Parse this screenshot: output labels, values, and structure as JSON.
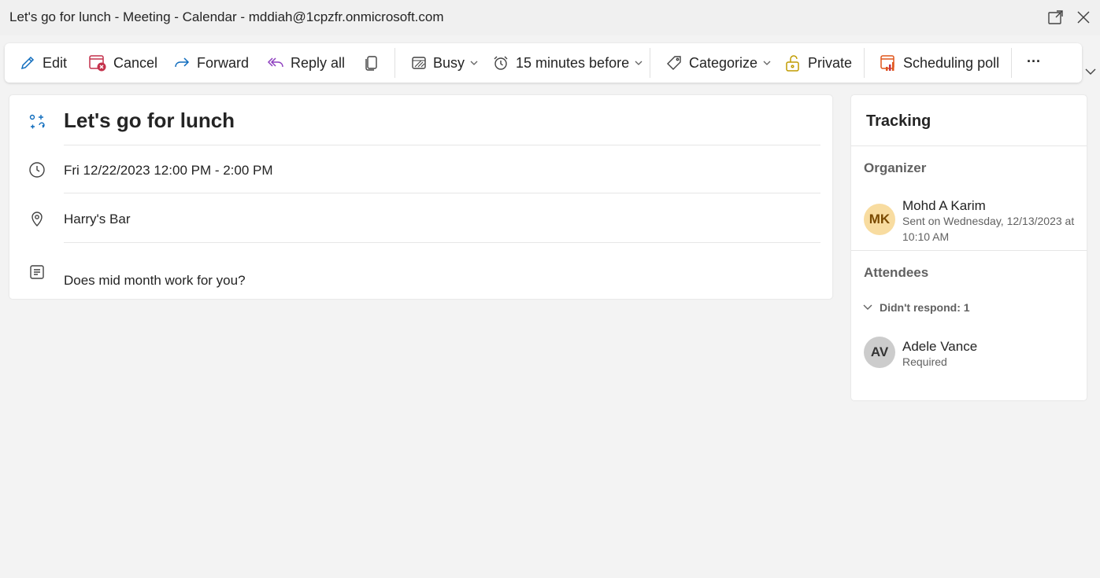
{
  "window": {
    "title": "Let's go for lunch - Meeting - Calendar - mddiah@1cpzfr.onmicrosoft.com"
  },
  "toolbar": {
    "edit": "Edit",
    "cancel": "Cancel",
    "forward": "Forward",
    "reply_all": "Reply all",
    "busy": "Busy",
    "reminder": "15 minutes before",
    "categorize": "Categorize",
    "private": "Private",
    "scheduling_poll": "Scheduling poll",
    "more": "···"
  },
  "meeting": {
    "title": "Let's go for lunch",
    "datetime": "Fri 12/22/2023 12:00 PM - 2:00 PM",
    "location": "Harry's Bar",
    "body": "Does mid month work for you?"
  },
  "tracking": {
    "header": "Tracking",
    "organizer_label": "Organizer",
    "organizer": {
      "initials": "MK",
      "name": "Mohd A Karim",
      "sent": "Sent on Wednesday, 12/13/2023 at 10:10 AM"
    },
    "attendees_label": "Attendees",
    "group_label": "Didn't respond: 1",
    "attendee": {
      "initials": "AV",
      "name": "Adele Vance",
      "role": "Required"
    }
  },
  "colors": {
    "accent": "#0f6cbd",
    "cancel_red": "#c4314b",
    "reply_purple": "#8e3fbf",
    "private_gold": "#c19c00",
    "poll_orange": "#e0561b",
    "organizer_avatar_bg": "#f8dca0",
    "organizer_avatar_fg": "#7a4a00",
    "attendee_avatar_bg": "#cccccc"
  }
}
